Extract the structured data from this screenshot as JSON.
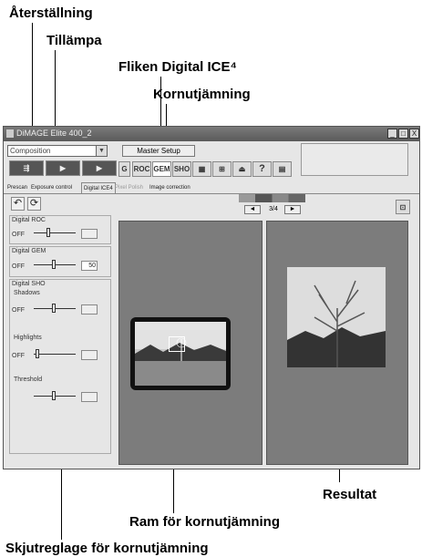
{
  "annotations": {
    "reset": "Återställning",
    "apply": "Tillämpa",
    "ice_tab": "Fliken Digital ICE⁴",
    "grain": "Kornutjämning",
    "result": "Resultat",
    "grain_frame": "Ram för kornutjämning",
    "grain_slider": "Skjutreglage för kornutjämning"
  },
  "window": {
    "title": "DiMAGE Elite 400_2",
    "controls": [
      "_",
      "□",
      "X"
    ]
  },
  "toolbar": {
    "combo_value": "Composition",
    "master_setup": "Master Setup",
    "help": "?"
  },
  "tabs": [
    "Prescan",
    "Exposure control",
    "Digital ICE4",
    "Pixel Polish",
    "Image correction"
  ],
  "nav": {
    "page": "3/4",
    "prev": "◄",
    "next": "►"
  },
  "panel": {
    "roc_title": "Digital ROC",
    "gem_title": "Digital GEM",
    "sho_title": "Digital SHO",
    "off": "OFF",
    "gem_value": "50",
    "shadows": "Shadows",
    "highlights": "Highlights",
    "threshold": "Threshold",
    "roc_value": "",
    "shadows_value": "",
    "highlights_value": "",
    "threshold_value": ""
  },
  "icons": {
    "undo": "undo-icon",
    "apply": "apply-icon"
  }
}
